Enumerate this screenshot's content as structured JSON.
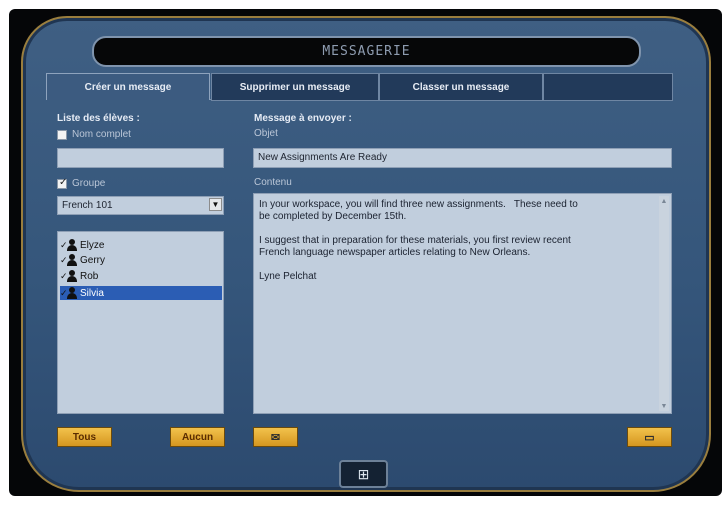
{
  "header": {
    "title": "MESSAGERIE"
  },
  "tabs": [
    {
      "label": "Créer un message"
    },
    {
      "label": "Supprimer un message"
    },
    {
      "label": "Classer un message"
    }
  ],
  "left": {
    "heading": "Liste des élèves :",
    "fullname_label": "Nom complet",
    "fullname_checked": false,
    "fullname_value": "",
    "group_label": "Groupe",
    "group_checked": true,
    "group_select": "French 101",
    "students": [
      {
        "name": "Elyze",
        "checked": true,
        "selected": false
      },
      {
        "name": "Gerry",
        "checked": true,
        "selected": false
      },
      {
        "name": "Rob",
        "checked": true,
        "selected": false
      },
      {
        "name": "Silvia",
        "checked": true,
        "selected": true
      }
    ],
    "btn_all": "Tous",
    "btn_none": "Aucun"
  },
  "right": {
    "heading": "Message à envoyer :",
    "subject_label": "Objet",
    "subject_value": "New Assignments Are Ready",
    "content_label": "Contenu",
    "content_value": "In your workspace, you will find three new assignments.   These need to\nbe completed by December 15th.\n\nI suggest that in preparation for these materials, you first review recent\nFrench language newspaper articles relating to New Orleans.\n\nLyne Pelchat"
  },
  "icons": {
    "attach": "attach-icon",
    "send": "send-icon",
    "layout": "layout-icon"
  }
}
